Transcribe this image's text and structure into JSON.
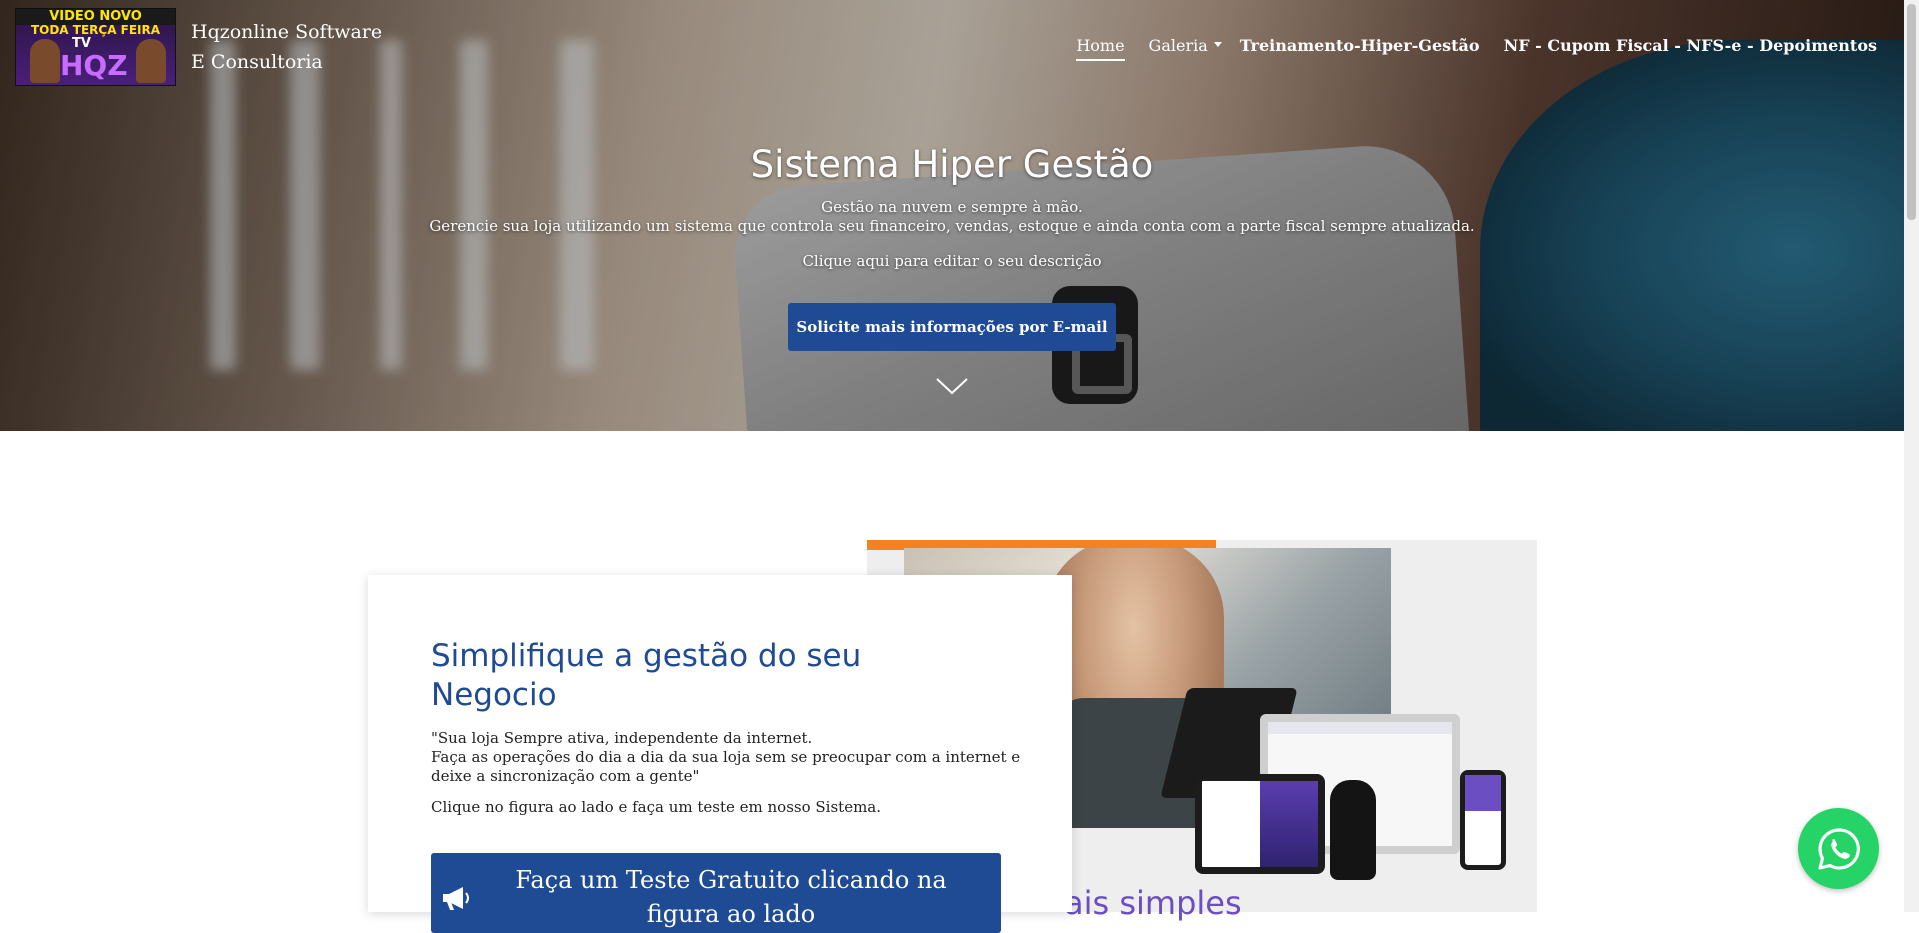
{
  "header": {
    "logo": {
      "line1": "VIDEO NOVO",
      "line2": "TODA TERÇA FEIRA",
      "line3": "TV",
      "line4": "HQZ"
    },
    "brand_line1": "Hqzonline Software",
    "brand_line2": "E Consultoria",
    "nav": [
      {
        "label": "Home",
        "active": true
      },
      {
        "label": "Galeria",
        "dropdown": true
      },
      {
        "label": "Treinamento-Hiper-Gestão"
      },
      {
        "label": "NF - Cupom Fiscal - NFS-e - Depoimentos"
      }
    ]
  },
  "hero": {
    "title": "Sistema Hiper Gestão",
    "subtitle1": "Gestão na nuvem e sempre à mão.",
    "subtitle2": "Gerencie sua loja utilizando um sistema que controla seu financeiro, vendas, estoque e ainda conta com a parte fiscal sempre atualizada.",
    "subtitle3": "Clique aqui para editar o seu descrição",
    "cta_label": "Solicite mais informações por E-mail"
  },
  "section": {
    "card_title": "Simplifique a gestão do seu Negocio",
    "quote_line1": "\"Sua loja Sempre ativa, independente da internet.",
    "quote_line2": "Faça as operações do dia a dia da sua loja sem se preocupar com a internet e deixe a sincronização com a gente\"",
    "note": "Clique no figura ao lado e faça um teste em nosso Sistema.",
    "cta_label": "Faça um Teste Gratuito clicando na figura ao lado",
    "image_caption_partial": "ais simples"
  },
  "colors": {
    "primary": "#1f4b94",
    "accent_orange": "#f58220",
    "whatsapp": "#25d366",
    "purple": "#6a4ec2"
  },
  "icons": {
    "whatsapp": "whatsapp-icon",
    "megaphone": "megaphone-icon",
    "chevron": "chevron-down-icon",
    "caret": "caret-down-icon"
  }
}
